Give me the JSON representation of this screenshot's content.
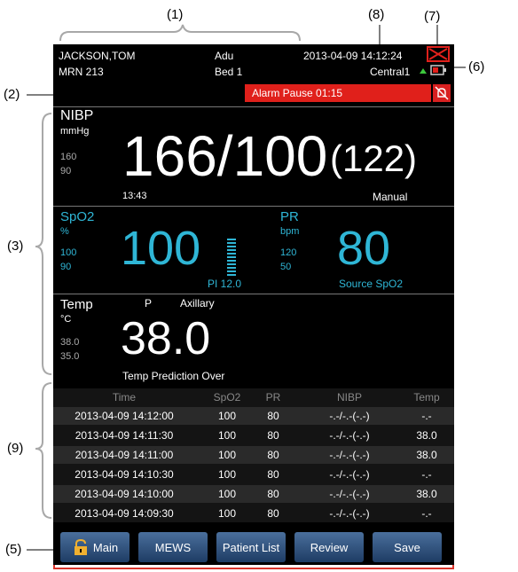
{
  "callouts": [
    "(1)",
    "(2)",
    "(3)",
    "(5)",
    "(6)",
    "(7)",
    "(8)",
    "(9)"
  ],
  "header": {
    "patient_name": "JACKSON,TOM",
    "mrn": "MRN 213",
    "patient_type": "Adu",
    "bed": "Bed 1",
    "datetime": "2013-04-09 14:12:24",
    "network": "Central1"
  },
  "alarm": {
    "text": "Alarm Pause  01:15"
  },
  "nibp": {
    "label": "NIBP",
    "unit": "mmHg",
    "limit_high": "160",
    "limit_low": "90",
    "value": "166/100",
    "mean": "(122)",
    "time": "13:43",
    "mode": "Manual"
  },
  "spo2": {
    "label": "SpO2",
    "unit": "%",
    "limit_high": "100",
    "limit_low": "90",
    "value": "100",
    "pi": "PI  12.0"
  },
  "pr": {
    "label": "PR",
    "unit": "bpm",
    "limit_high": "120",
    "limit_low": "50",
    "value": "80",
    "source": "Source SpO2"
  },
  "temp": {
    "label": "Temp",
    "unit": "°C",
    "site_type": "P",
    "site": "Axillary",
    "limit_high": "38.0",
    "limit_low": "35.0",
    "value": "38.0",
    "note": "Temp Prediction Over"
  },
  "trend": {
    "headers": [
      "Time",
      "SpO2",
      "PR",
      "NIBP",
      "Temp"
    ],
    "rows": [
      [
        "2013-04-09   14:12:00",
        "100",
        "80",
        "-.-/-.-(-.-)",
        "-.-"
      ],
      [
        "2013-04-09   14:11:30",
        "100",
        "80",
        "-.-/-.-(-.-)",
        "38.0"
      ],
      [
        "2013-04-09   14:11:00",
        "100",
        "80",
        "-.-/-.-(-.-)",
        "38.0"
      ],
      [
        "2013-04-09   14:10:30",
        "100",
        "80",
        "-.-/-.-(-.-)",
        "-.-"
      ],
      [
        "2013-04-09   14:10:00",
        "100",
        "80",
        "-.-/-.-(-.-)",
        "38.0"
      ],
      [
        "2013-04-09   14:09:30",
        "100",
        "80",
        "-.-/-.-(-.-)",
        "-.-"
      ]
    ]
  },
  "nav": {
    "main": "Main",
    "mews": "MEWS",
    "patient_list": "Patient List",
    "review": "Review",
    "save": "Save"
  },
  "colors": {
    "spo2": "#2fb6d6",
    "alarm": "#e0201b",
    "callout_box": "#d9342b",
    "bracket": "#a8a8a8",
    "button": "#2a4a78"
  },
  "icons": [
    "close-box-icon",
    "network-status-icon",
    "battery-icon",
    "alarm-off-icon",
    "lock-icon",
    "signal-bar-icon"
  ]
}
